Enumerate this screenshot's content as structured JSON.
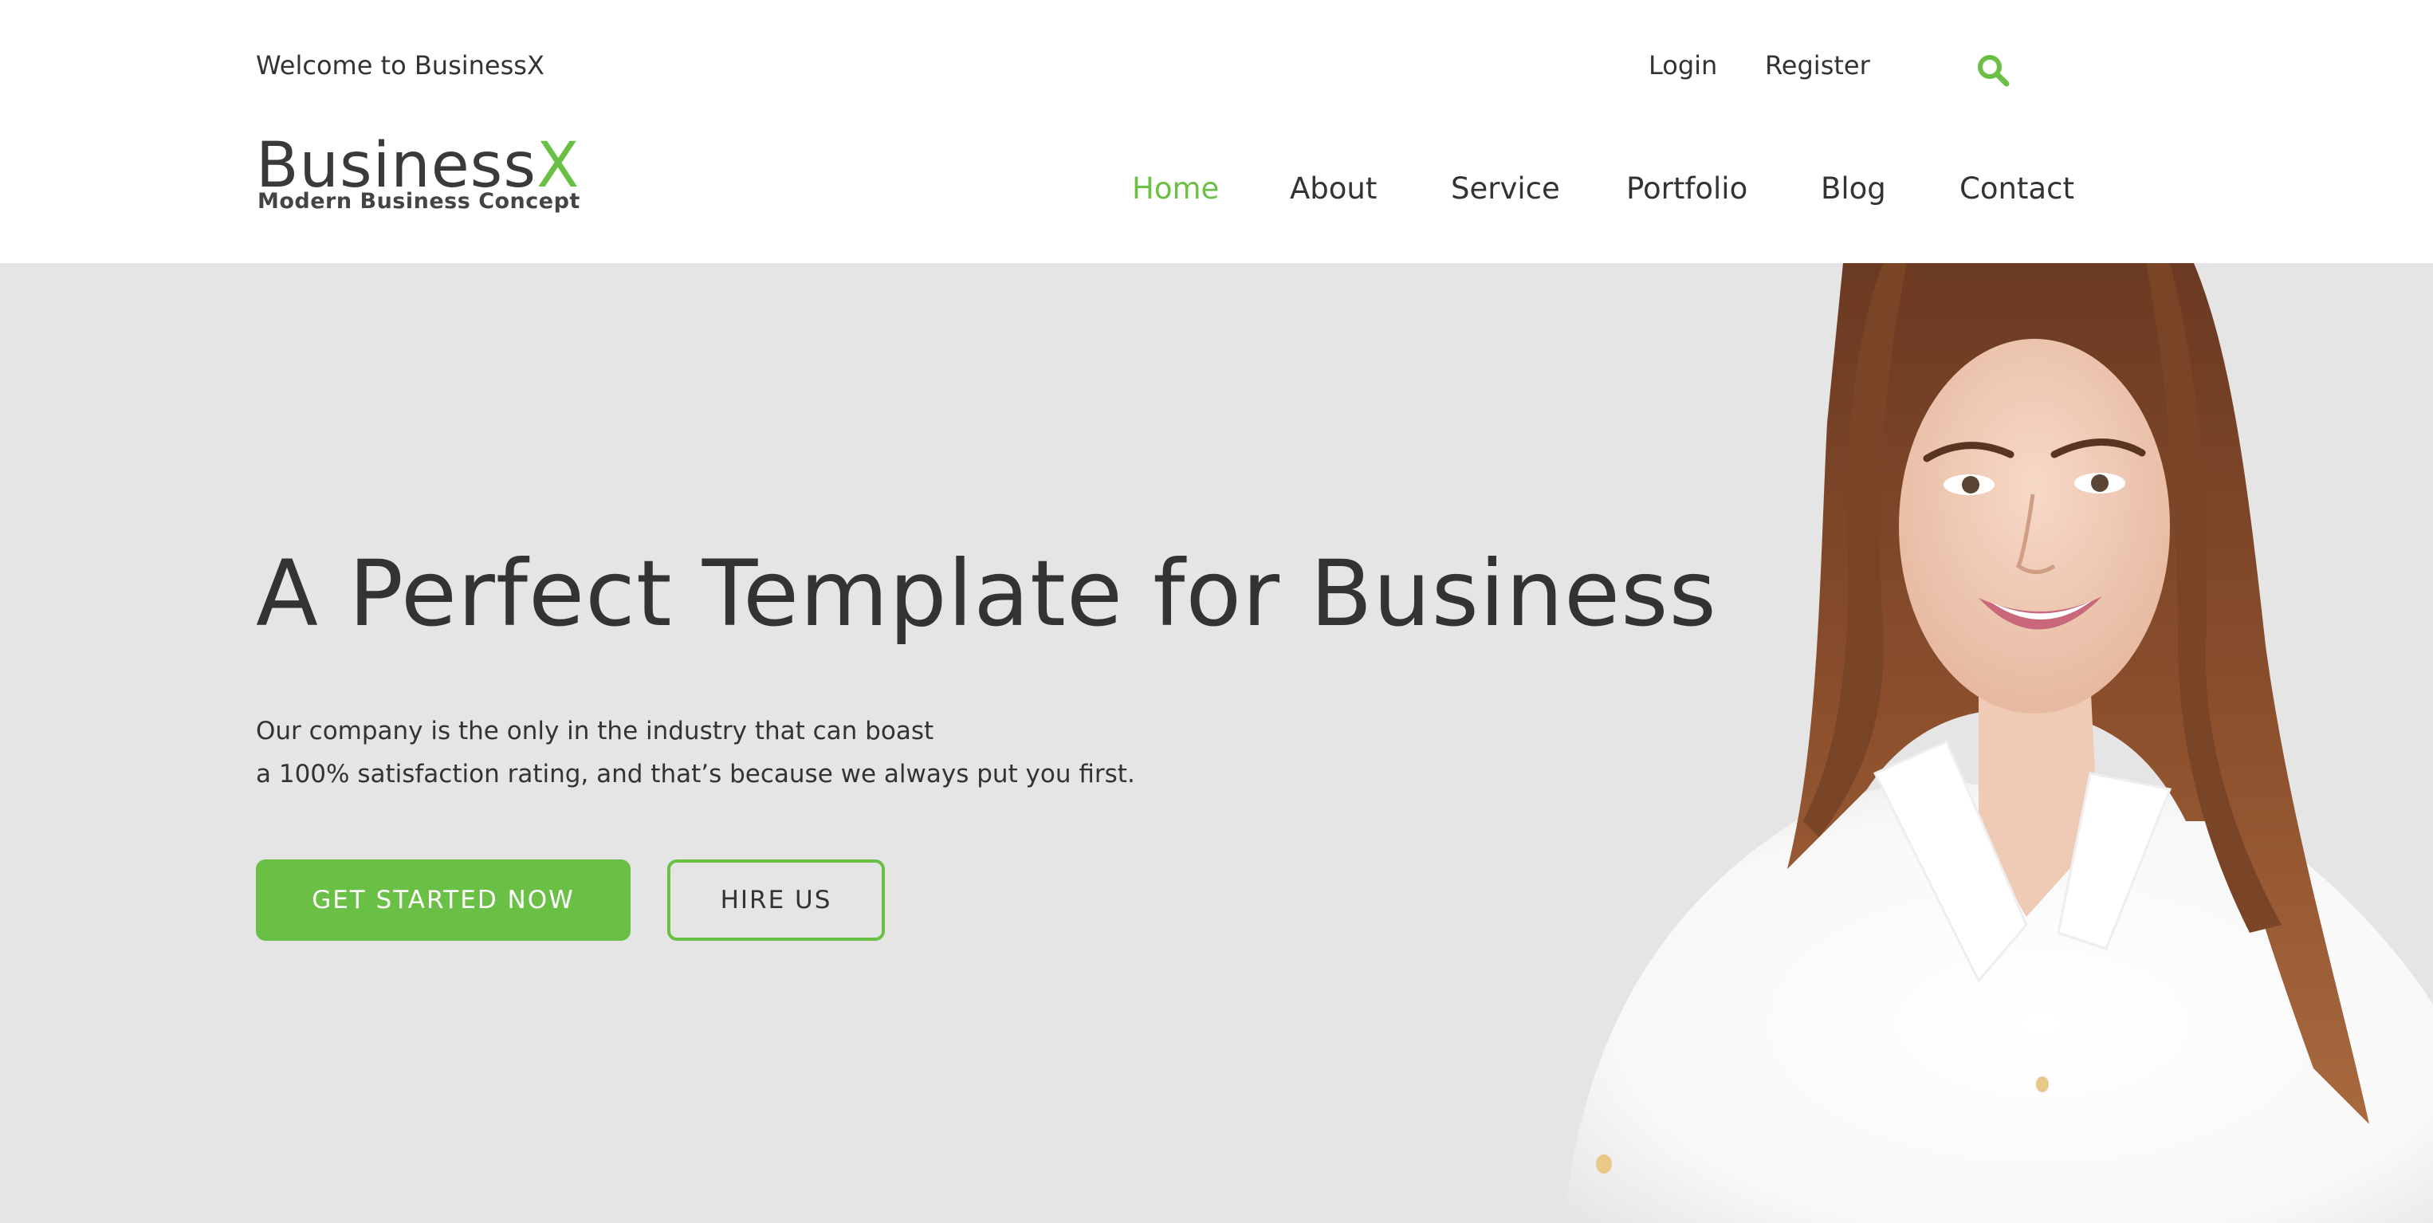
{
  "topbar": {
    "welcome": "Welcome to BusinessX",
    "login_label": "Login",
    "register_label": "Register",
    "search_icon": "search-icon"
  },
  "logo": {
    "name_part1": "Business",
    "name_part2": "X",
    "tagline": "Modern Business Concept"
  },
  "nav": {
    "items": [
      {
        "label": "Home",
        "active": true
      },
      {
        "label": "About",
        "active": false
      },
      {
        "label": "Service",
        "active": false
      },
      {
        "label": "Portfolio",
        "active": false
      },
      {
        "label": "Blog",
        "active": false
      },
      {
        "label": "Contact",
        "active": false
      }
    ]
  },
  "hero": {
    "title": "A Perfect Template for Business",
    "text_line1": "Our company is the only in the industry that can boast",
    "text_line2": "a 100% satisfaction rating, and that’s because we always put you first.",
    "primary_button": "GET STARTED NOW",
    "secondary_button": "HIRE US",
    "image": "smiling-woman-photo"
  },
  "colors": {
    "accent": "#6abf45",
    "text": "#333333",
    "hero_bg": "#e5e5e5",
    "header_bg": "#ffffff"
  }
}
